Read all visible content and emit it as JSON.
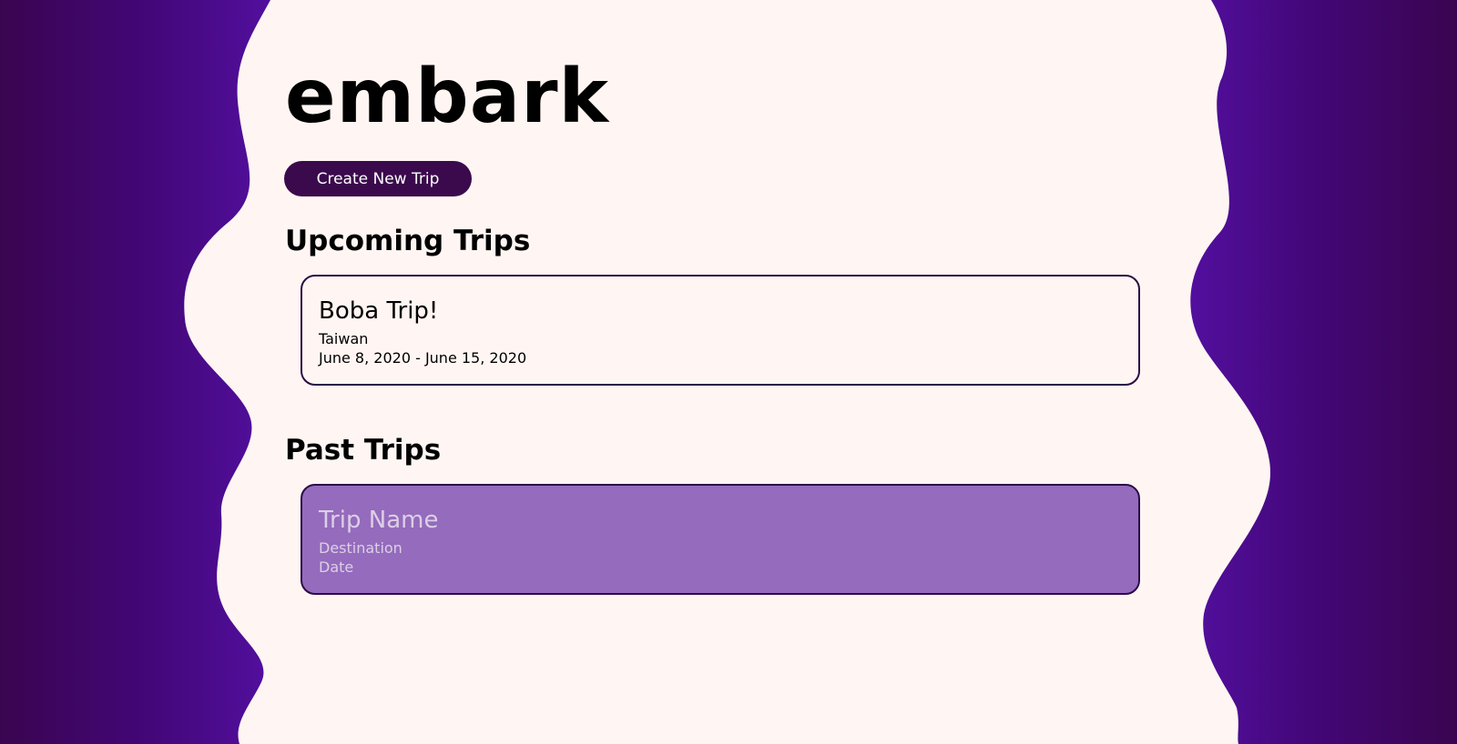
{
  "app": {
    "logo": "embark"
  },
  "actions": {
    "create_trip_label": "Create New Trip"
  },
  "upcoming": {
    "title": "Upcoming Trips",
    "trips": [
      {
        "name": "Boba Trip!",
        "destination": "Taiwan",
        "dates": "June 8, 2020 - June 15, 2020"
      }
    ]
  },
  "past": {
    "title": "Past Trips",
    "trips": [
      {
        "name": "Trip Name",
        "destination": "Destination",
        "dates": "Date"
      }
    ]
  },
  "colors": {
    "background": "#fff6f3",
    "wave_dark": "#3a0550",
    "wave_light": "#520f9e",
    "button": "#3b0a4d",
    "card_border": "#2c0b48",
    "past_card_fill": "#956bbd"
  }
}
